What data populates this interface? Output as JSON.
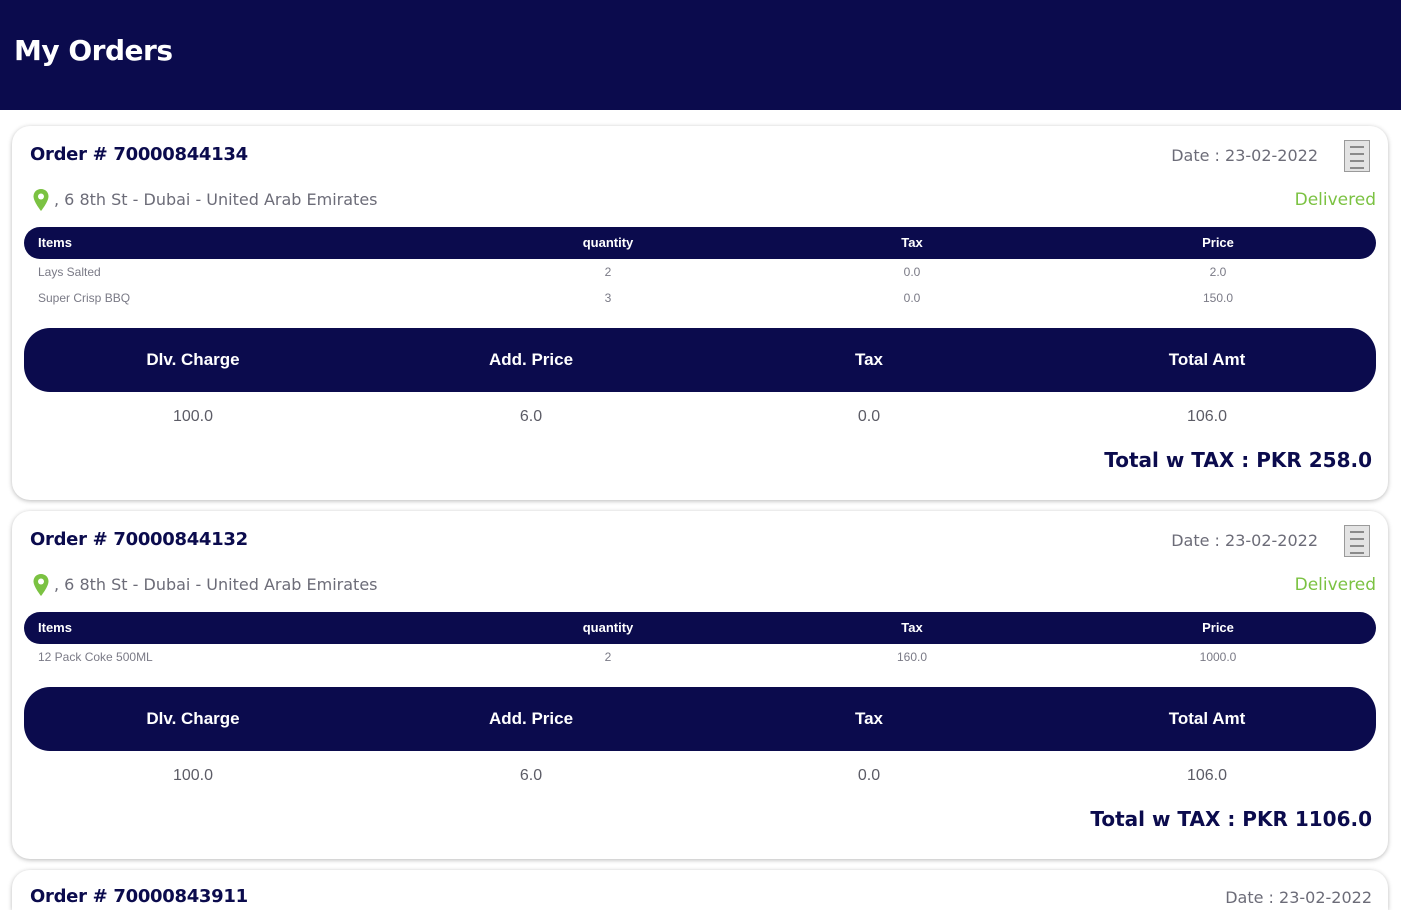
{
  "header": {
    "title": "My Orders"
  },
  "colors": {
    "primary": "#0b0b4d",
    "status_delivered": "#7bc242",
    "muted": "#6c6c78"
  },
  "icons": {
    "location": "map-pin-icon",
    "receipt": "receipt-icon"
  },
  "item_columns": [
    "Items",
    "quantity",
    "Tax",
    "Price"
  ],
  "summary_columns": [
    "Dlv. Charge",
    "Add. Price",
    "Tax",
    "Total Amt"
  ],
  "orders": [
    {
      "order_no": "Order # 70000844134",
      "date": "Date : 23-02-2022",
      "address": ", 6 8th St - Dubai - United Arab Emirates",
      "status": "Delivered",
      "items": [
        {
          "name": "Lays Salted",
          "quantity": "2",
          "tax": "0.0",
          "price": "2.0"
        },
        {
          "name": "Super Crisp BBQ",
          "quantity": "3",
          "tax": "0.0",
          "price": "150.0"
        }
      ],
      "summary": {
        "dlv_charge": "100.0",
        "add_price": "6.0",
        "tax": "0.0",
        "total_amt": "106.0"
      },
      "total_with_tax": "Total w TAX : PKR 258.0"
    },
    {
      "order_no": "Order # 70000844132",
      "date": "Date : 23-02-2022",
      "address": ", 6 8th St - Dubai - United Arab Emirates",
      "status": "Delivered",
      "items": [
        {
          "name": "12 Pack Coke 500ML",
          "quantity": "2",
          "tax": "160.0",
          "price": "1000.0"
        }
      ],
      "summary": {
        "dlv_charge": "100.0",
        "add_price": "6.0",
        "tax": "0.0",
        "total_amt": "106.0"
      },
      "total_with_tax": "Total w TAX : PKR 1106.0"
    },
    {
      "order_no": "Order # 70000843911",
      "date": "Date : 23-02-2022"
    }
  ]
}
